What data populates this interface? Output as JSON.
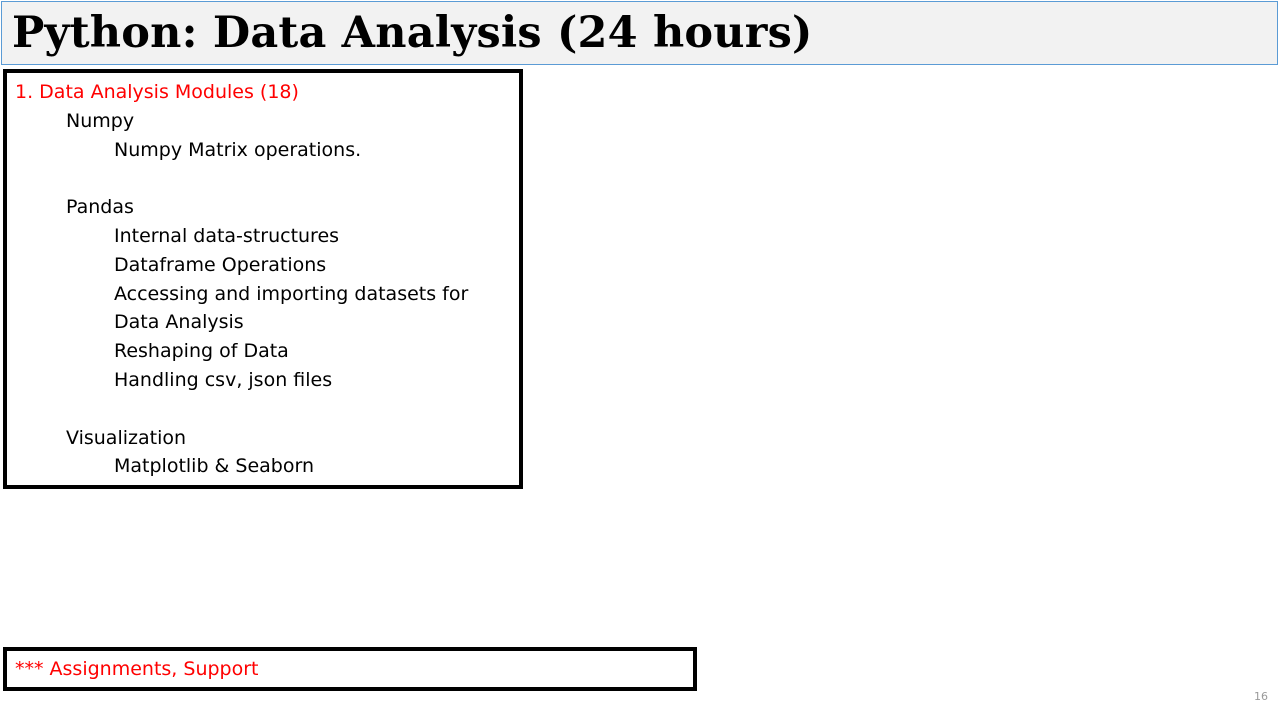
{
  "slide": {
    "title": "Python: Data Analysis (24 hours)",
    "page_number": "16"
  },
  "content": {
    "heading": "1.  Data Analysis Modules  (18)",
    "lines": [
      {
        "level": 1,
        "text": "Numpy"
      },
      {
        "level": 2,
        "text": "Numpy Matrix operations."
      },
      {
        "level": 0,
        "text": ""
      },
      {
        "level": 1,
        "text": "Pandas"
      },
      {
        "level": 2,
        "text": "Internal data-structures"
      },
      {
        "level": 2,
        "text": "Dataframe Operations"
      },
      {
        "level": 2,
        "text": "Accessing and importing datasets for"
      },
      {
        "level": 2,
        "text": "Data Analysis"
      },
      {
        "level": 2,
        "text": "Reshaping of Data"
      },
      {
        "level": 2,
        "text": "Handling csv, json files"
      },
      {
        "level": 0,
        "text": ""
      },
      {
        "level": 1,
        "text": "Visualization"
      },
      {
        "level": 2,
        "text": "Matplotlib & Seaborn"
      }
    ]
  },
  "footer": {
    "text": "*** Assignments, Support"
  },
  "colors": {
    "heading": "#ff0000",
    "title_background": "#f2f2f2",
    "title_border": "#5b9bd5"
  }
}
